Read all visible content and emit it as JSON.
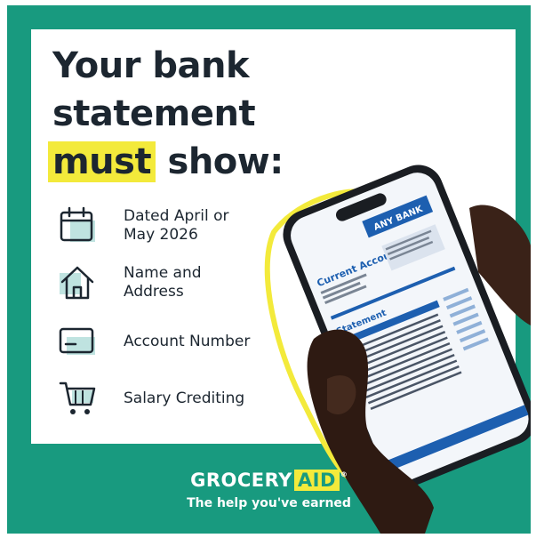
{
  "headline": {
    "line1": "Your bank",
    "line2": "statement",
    "highlight": "must",
    "line3_rest": " show:"
  },
  "requirements": [
    {
      "icon": "calendar-icon",
      "line1": "Dated April or",
      "line2": "May 2026"
    },
    {
      "icon": "house-icon",
      "line1": "Name and",
      "line2": "Address"
    },
    {
      "icon": "card-icon",
      "line1": "Account Number",
      "line2": ""
    },
    {
      "icon": "shopping-cart-icon",
      "line1": "Salary Crediting",
      "line2": ""
    }
  ],
  "phone_screen": {
    "bank_name": "ANY BANK",
    "account_title": "Current Account",
    "statement_title": "Statement"
  },
  "brand": {
    "logo_part1": "GROCERY",
    "logo_part2": "AID",
    "logo_mark": "®",
    "tagline": "The help you've earned"
  },
  "colors": {
    "teal": "#189a7f",
    "yellow": "#f3ea3b",
    "dark_text": "#1c2630",
    "icon_fill": "#bfe3e0",
    "bank_blue": "#1d5fb0"
  }
}
